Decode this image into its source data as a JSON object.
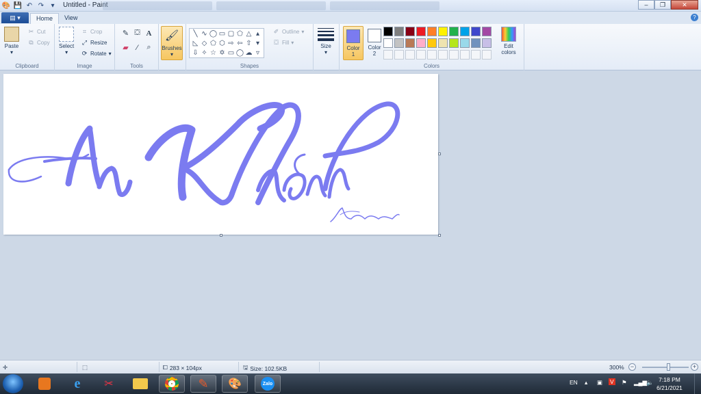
{
  "window": {
    "title": "Untitled - Paint"
  },
  "tabs": {
    "file": "▤ ▾",
    "home": "Home",
    "view": "View"
  },
  "clipboard": {
    "paste": "Paste",
    "cut": "Cut",
    "copy": "Copy",
    "label": "Clipboard"
  },
  "image": {
    "select": "Select",
    "crop": "Crop",
    "resize": "Resize",
    "rotate": "Rotate",
    "label": "Image"
  },
  "tools": {
    "label": "Tools"
  },
  "brushes": {
    "label": "Brushes"
  },
  "shapes": {
    "label": "Shapes",
    "outline": "Outline",
    "fill": "Fill"
  },
  "size": {
    "label": "Size"
  },
  "colors": {
    "color1": "Color",
    "color1_num": "1",
    "color2": "Color",
    "color2_num": "2",
    "edit": "Edit",
    "edit2": "colors",
    "label": "Colors",
    "color1_value": "#7b7bf0",
    "color2_value": "#ffffff",
    "palette_row1": [
      "#000000",
      "#7f7f7f",
      "#880015",
      "#ed1c24",
      "#ff7f27",
      "#fff200",
      "#22b14c",
      "#00a2e8",
      "#3f48cc",
      "#a349a4"
    ],
    "palette_row2": [
      "#ffffff",
      "#c3c3c3",
      "#b97a57",
      "#ffaec9",
      "#ffc90e",
      "#efe4b0",
      "#b5e61d",
      "#99d9ea",
      "#7092be",
      "#c8bfe7"
    ]
  },
  "canvas": {
    "ink_color": "#7b7bf0"
  },
  "status": {
    "dimensions": "283 × 104px",
    "size": "Size: 102.5KB",
    "zoom": "300%"
  },
  "taskbar": {
    "lang": "EN",
    "time": "7:18 PM",
    "date": "6/21/2021",
    "zalo": "Zalo"
  }
}
